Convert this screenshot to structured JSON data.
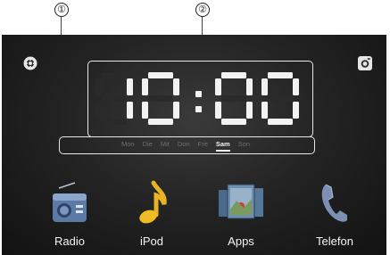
{
  "callouts": {
    "one": "①",
    "two": "②"
  },
  "clock": {
    "time": "10:00"
  },
  "days": [
    {
      "label": "Mon",
      "active": false
    },
    {
      "label": "Die",
      "active": false
    },
    {
      "label": "Mit",
      "active": false
    },
    {
      "label": "Don",
      "active": false
    },
    {
      "label": "Fre",
      "active": false
    },
    {
      "label": "Sam",
      "active": true
    },
    {
      "label": "Son",
      "active": false
    }
  ],
  "apps": [
    {
      "label": "Radio",
      "icon": "radio-icon"
    },
    {
      "label": "iPod",
      "icon": "music-note-icon"
    },
    {
      "label": "Apps",
      "icon": "apps-icon"
    },
    {
      "label": "Telefon",
      "icon": "phone-icon"
    }
  ],
  "corner_buttons": {
    "left": "settings-icon",
    "right": "camera-icon"
  },
  "colors": {
    "segment_on": "#f2f2f2",
    "segment_off": "#2a2a2a",
    "frame": "#e8e8e8",
    "screen": "#1e1e1e"
  }
}
